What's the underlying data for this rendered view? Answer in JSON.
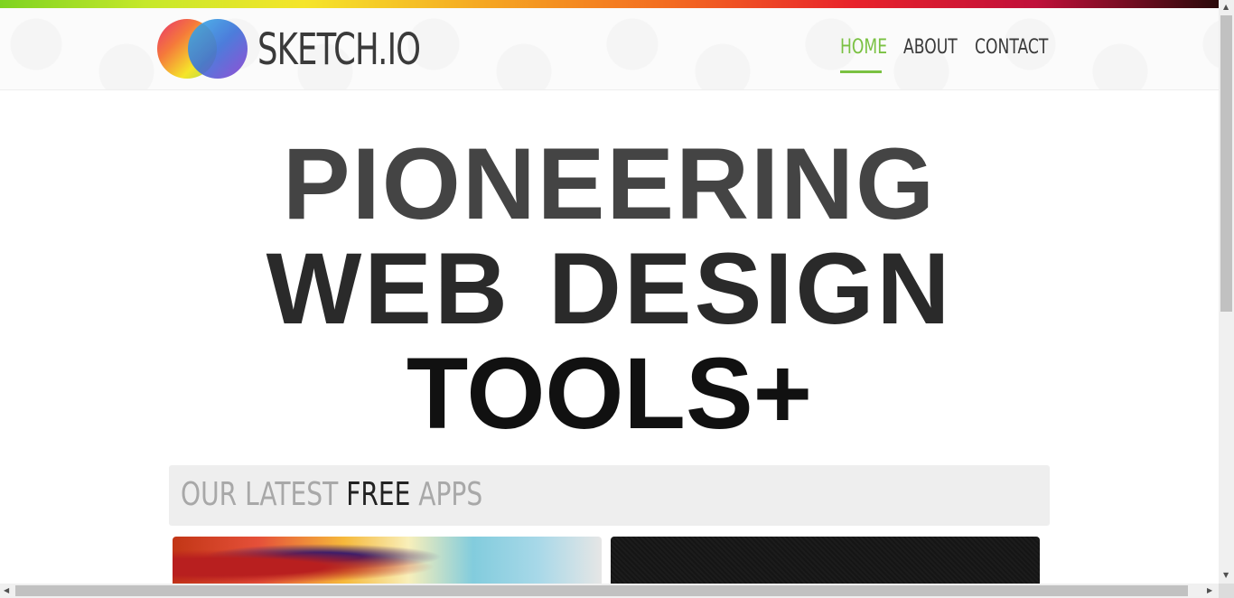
{
  "header": {
    "logo_text": "SKETCH.IO",
    "nav": [
      {
        "label": "HOME",
        "active": true
      },
      {
        "label": "ABOUT",
        "active": false
      },
      {
        "label": "CONTACT",
        "active": false
      }
    ],
    "accent_color": "#7ac142"
  },
  "hero": {
    "line1": "PIONEERING",
    "line2": "WEB DESIGN",
    "line3": "TOOLS+"
  },
  "apps": {
    "title_pre": "OUR LATEST ",
    "title_strong": "FREE",
    "title_post": " APPS"
  },
  "icons": {
    "logo": "overlapping-color-circles-logo",
    "scroll_up": "arrow-up-icon",
    "scroll_down": "arrow-down-icon",
    "scroll_left": "arrow-left-icon",
    "scroll_right": "arrow-right-icon"
  }
}
